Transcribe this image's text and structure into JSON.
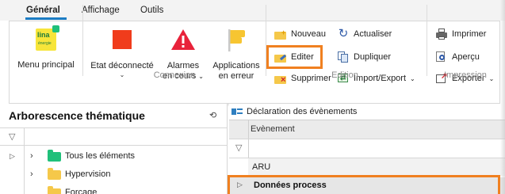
{
  "tabs": [
    {
      "label": "Général",
      "active": true
    },
    {
      "label": "Affichage",
      "active": false
    },
    {
      "label": "Outils",
      "active": false
    }
  ],
  "ribbon": {
    "menu_principal": {
      "label": "Menu principal",
      "logo_text": "lina",
      "logo_sub": "énergie",
      "icon": "lina-logo-icon"
    },
    "etat": {
      "label": "Etat déconnecté",
      "icon": "red-square-icon",
      "color": "#f03c1c"
    },
    "alarmes": {
      "label_line1": "Alarmes",
      "label_line2": "en cours",
      "icon": "warning-triangle-icon",
      "color": "#e8223a"
    },
    "applications": {
      "label_line1": "Applications",
      "label_line2": "en erreur",
      "icon": "yellow-flag-icon",
      "color": "#f7c531"
    },
    "connexion_group": "Connexion",
    "nouveau": "Nouveau",
    "editer": "Editer",
    "supprimer": "Supprimer",
    "actualiser": "Actualiser",
    "dupliquer": "Dupliquer",
    "import_export": "Import/Export",
    "edition_group": "Edition",
    "imprimer": "Imprimer",
    "apercu": "Aperçu",
    "exporter": "Exporter",
    "impression_group": "Impression",
    "highlight_color": "#f08020"
  },
  "tree_panel": {
    "title": "Arborescence thématique",
    "items": [
      {
        "label": "Tous les éléments",
        "folder_color": "#1fc07a"
      },
      {
        "label": "Hypervision",
        "folder_color": "#f5c84a"
      },
      {
        "label": "Forçage",
        "folder_color": "#f5c84a"
      }
    ]
  },
  "events_panel": {
    "tab_label": "Déclaration des évènements",
    "column_header": "Evènement",
    "rows": [
      "ARU",
      "Données process"
    ]
  }
}
